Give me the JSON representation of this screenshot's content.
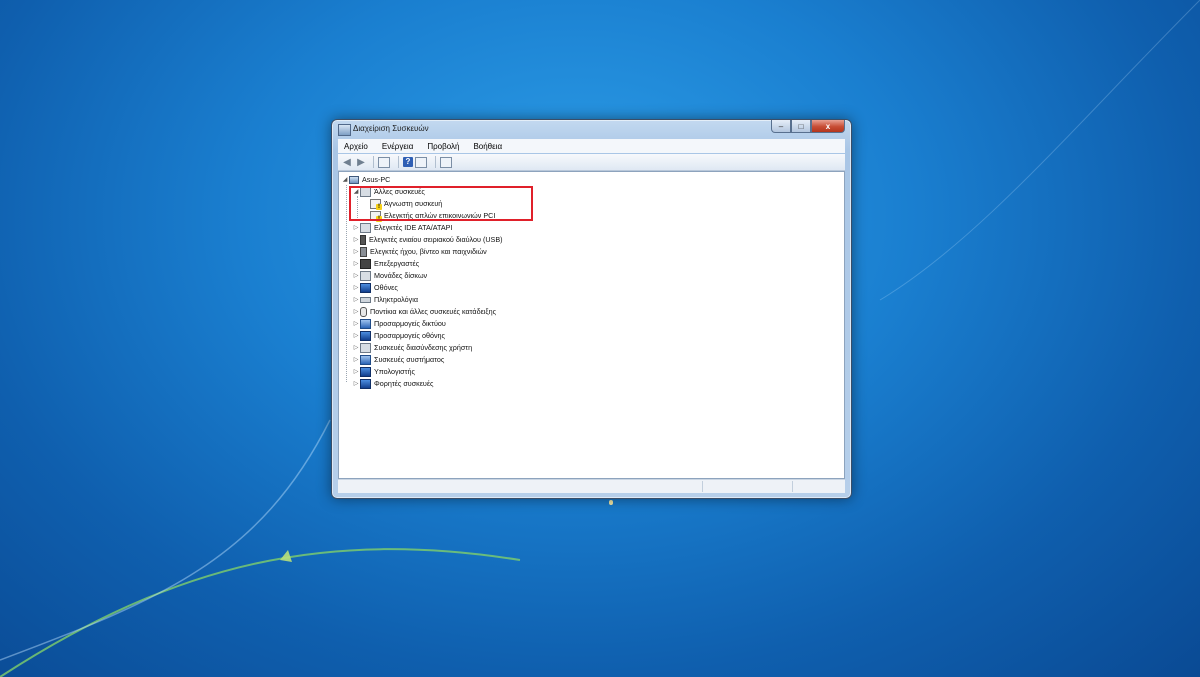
{
  "window": {
    "title": "Διαχείριση Συσκευών",
    "caption_buttons": [
      "–",
      "□",
      "x"
    ]
  },
  "menu": [
    "Αρχείο",
    "Ενέργεια",
    "Προβολή",
    "Βοήθεια"
  ],
  "toolbar": {
    "back_icon": "back-arrow-icon",
    "forward_icon": "forward-arrow-icon",
    "help_label": "?"
  },
  "tree": {
    "root": "Asus-PC",
    "expanded_category": "Άλλες συσκευές",
    "children": [
      "Άγνωστη συσκευή",
      "Ελεγκτής απλών επικοινωνιών PCI"
    ],
    "categories": [
      "Ελεγκτές IDE ATA/ATAPI",
      "Ελεγκτές ενιαίου σειριακού διαύλου (USB)",
      "Ελεγκτές ήχου, βίντεο και παιχνιδιών",
      "Επεξεργαστές",
      "Μονάδες δίσκων",
      "Οθόνες",
      "Πληκτρολόγια",
      "Ποντίκια και άλλες συσκευές κατάδειξης",
      "Προσαρμογείς δικτύου",
      "Προσαρμογείς οθόνης",
      "Συσκευές διασύνδεσης χρήστη",
      "Συσκευές συστήματος",
      "Υπολογιστής",
      "Φορητές συσκευές"
    ]
  },
  "colors": {
    "highlight_border": "#e0202a",
    "desktop": "#1a7fd0"
  }
}
